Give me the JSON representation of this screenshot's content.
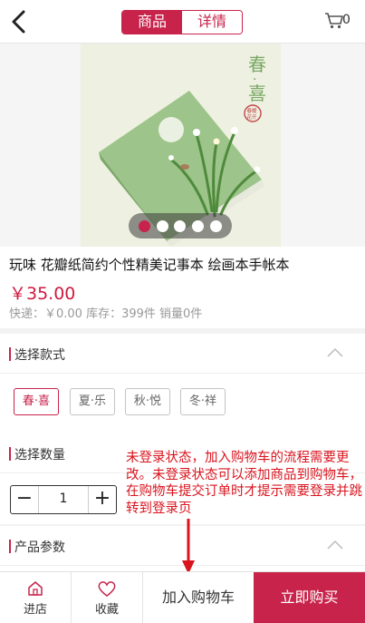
{
  "header": {
    "tabs": [
      {
        "label": "商品",
        "active": true
      },
      {
        "label": "详情",
        "active": false
      }
    ],
    "cart_count": "0"
  },
  "gallery": {
    "image_text": "春·喜",
    "seal_text": "春暖花开",
    "slide_count": 5,
    "active_slide": 1
  },
  "product": {
    "title": "玩味 花瓣纸简约个性精美记事本 绘画本手帐本",
    "price": "￥35.00",
    "meta": "快递：￥0.00 库存：399件 销量0件"
  },
  "style_section": {
    "label": "选择款式",
    "options": [
      "春·喜",
      "夏·乐",
      "秋·悦",
      "冬·祥"
    ],
    "selected": "春·喜"
  },
  "qty_section": {
    "label": "选择数量",
    "minus": "−",
    "value": "1",
    "plus": "+"
  },
  "params_section": {
    "label": "产品参数"
  },
  "annotation": {
    "text": "未登录状态，加入购物车的流程需要更改。未登录状态可以添加商品到购物车，在购物车提交订单时才提示需要登录并跳转到登录页"
  },
  "bottom_bar": {
    "shop_label": "进店",
    "fav_label": "收藏",
    "add_cart_label": "加入购物车",
    "buy_label": "立即购买"
  },
  "colors": {
    "accent": "#c8234b",
    "note": "#d9141e"
  }
}
